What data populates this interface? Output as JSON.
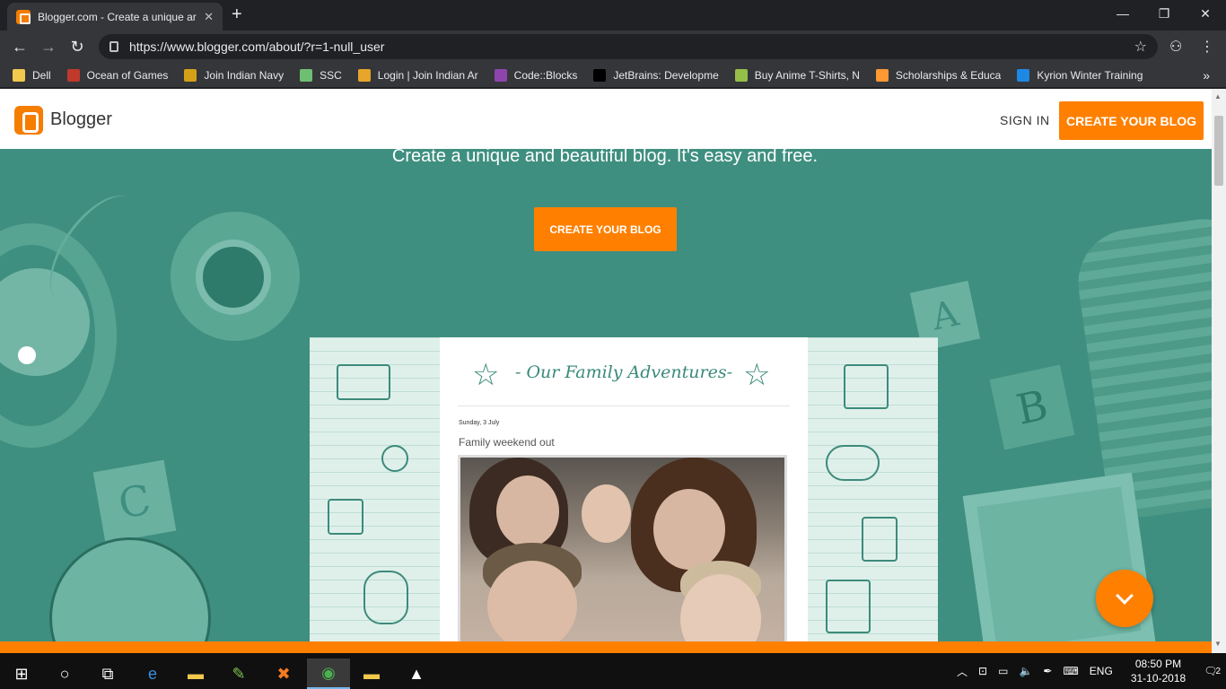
{
  "browser": {
    "tab_title": "Blogger.com - Create a unique ar",
    "url": "https://www.blogger.com/about/?r=1-null_user",
    "bookmarks": [
      {
        "label": "Dell",
        "color": "#f2c94c"
      },
      {
        "label": "Ocean of Games",
        "color": "#c0392b"
      },
      {
        "label": "Join Indian Navy",
        "color": "#d4a017"
      },
      {
        "label": "SSC",
        "color": "#6fbf73"
      },
      {
        "label": "Login | Join Indian Ar",
        "color": "#e7a52b"
      },
      {
        "label": "Code::Blocks",
        "color": "#8e44ad"
      },
      {
        "label": "JetBrains: Developme",
        "color": "#000000"
      },
      {
        "label": "Buy Anime T-Shirts, N",
        "color": "#95bf47"
      },
      {
        "label": "Scholarships & Educa",
        "color": "#ff9933"
      },
      {
        "label": "Kyrion Winter Training",
        "color": "#1e88e5"
      }
    ]
  },
  "page": {
    "brand": "Blogger",
    "sign_in": "SIGN IN",
    "create_top": "CREATE YOUR BLOG",
    "hero_text": "Create a unique and beautiful blog. It's easy and free.",
    "create_mid": "CREATE YOUR BLOG",
    "block_a": "A",
    "block_b": "B",
    "block_c": "C"
  },
  "preview": {
    "blog_title": "- Our Family Adventures-",
    "post_date": "Sunday, 3 July",
    "post_title": "Family weekend out"
  },
  "taskbar": {
    "lang": "ENG",
    "time": "08:50 PM",
    "date": "31-10-2018",
    "notif_count": "2"
  },
  "colors": {
    "brand_orange": "#ff8000",
    "teal_bg": "#3f8f80"
  }
}
